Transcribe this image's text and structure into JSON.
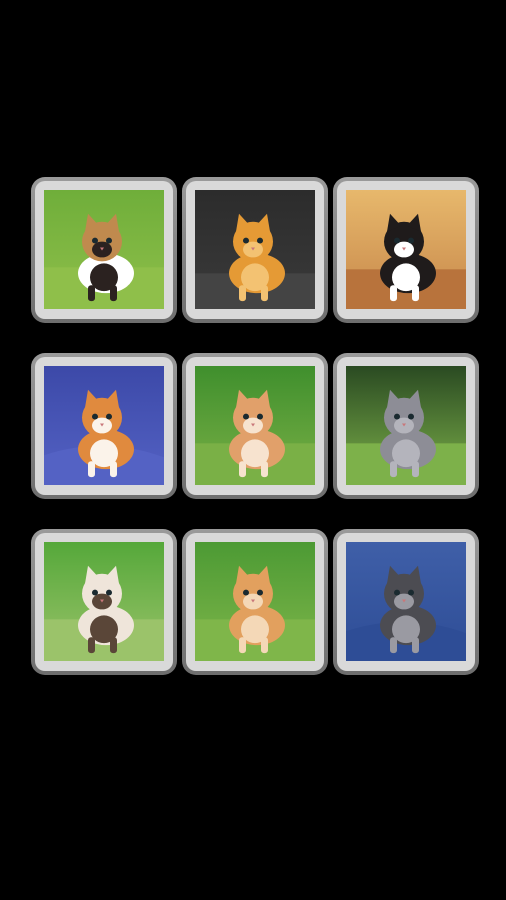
{
  "screen": {
    "background_color": "#000000"
  },
  "tiles": [
    {
      "name": "calico-kitten-photo",
      "bg_top": "#6fae3a",
      "bg_bottom": "#8fbf4a",
      "fur": "#ffffff",
      "fur2": "#2b2220",
      "fur3": "#c08a4e",
      "scene": "grass"
    },
    {
      "name": "orange-kitten-stretching-photo",
      "bg_top": "#2c2c2c",
      "bg_bottom": "#3a3a3a",
      "fur": "#e59a35",
      "fur2": "#f3c272",
      "fur3": "#e59a35",
      "scene": "dark"
    },
    {
      "name": "black-kitten-photo",
      "bg_top": "#e7b86c",
      "bg_bottom": "#c7874a",
      "fur": "#1f1b1b",
      "fur2": "#ffffff",
      "fur3": "#1f1b1b",
      "scene": "floor"
    },
    {
      "name": "orange-white-fluffy-kitten-photo",
      "bg_top": "#3c49a8",
      "bg_bottom": "#5462c4",
      "fur": "#e08a3e",
      "fur2": "#fbf3ea",
      "fur3": "#e08a3e",
      "scene": "blue"
    },
    {
      "name": "ginger-kitten-standing-photo",
      "bg_top": "#3f8f2d",
      "bg_bottom": "#7ab046",
      "fur": "#e1a06a",
      "fur2": "#f7e3cf",
      "fur3": "#e1a06a",
      "scene": "grass"
    },
    {
      "name": "grey-fluffy-kitten-photo",
      "bg_top": "#2a4a22",
      "bg_bottom": "#7db14a",
      "fur": "#8d8d96",
      "fur2": "#b4b4bc",
      "fur3": "#8d8d96",
      "scene": "grass"
    },
    {
      "name": "siamese-kitten-photo",
      "bg_top": "#55a83a",
      "bg_bottom": "#9bc36a",
      "fur": "#efe5da",
      "fur2": "#5a4638",
      "fur3": "#efe5da",
      "scene": "grass"
    },
    {
      "name": "orange-kitten-walking-photo",
      "bg_top": "#4c9a34",
      "bg_bottom": "#7fb64a",
      "fur": "#e2a05e",
      "fur2": "#f4d8b7",
      "fur3": "#e2a05e",
      "scene": "grass"
    },
    {
      "name": "grey-tabby-kitten-photo",
      "bg_top": "#3f5fa8",
      "bg_bottom": "#2e4d96",
      "fur": "#4c4c52",
      "fur2": "#9a9aa2",
      "fur3": "#4c4c52",
      "scene": "blue"
    }
  ]
}
